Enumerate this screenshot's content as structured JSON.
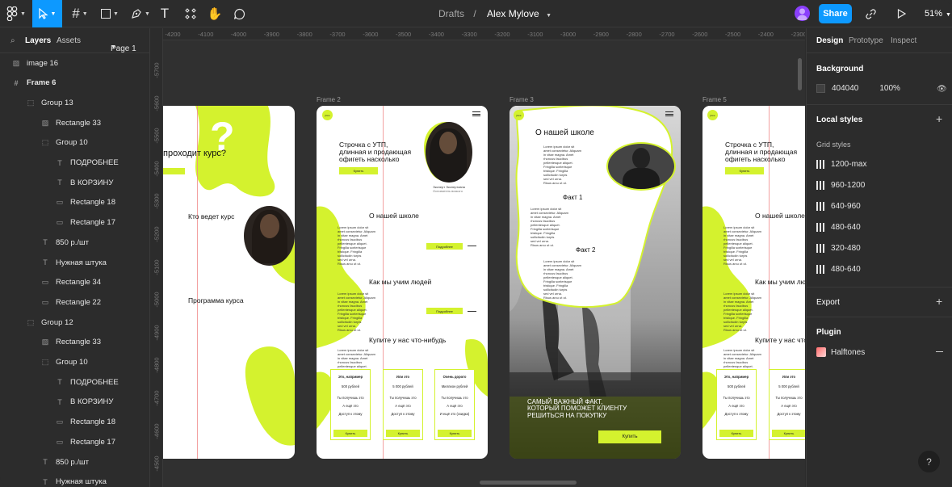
{
  "toolbar": {
    "breadcrumb_project": "Drafts",
    "file_name": "Alex Mylove",
    "share_label": "Share",
    "zoom_level": "51%"
  },
  "left_panel": {
    "tab_layers": "Layers",
    "tab_assets": "Assets",
    "page_selector": "Page 1",
    "layers": [
      {
        "name": "image 16",
        "icon": "image-icon"
      },
      {
        "name": "Frame 6",
        "icon": "frame-icon"
      },
      {
        "name": "Group 13",
        "icon": "group-icon"
      },
      {
        "name": "Rectangle 33",
        "icon": "image-icon"
      },
      {
        "name": "Group 10",
        "icon": "group-icon"
      },
      {
        "name": "ПОДРОБНЕЕ",
        "icon": "text-icon"
      },
      {
        "name": "В КОРЗИНУ",
        "icon": "text-icon"
      },
      {
        "name": "Rectangle 18",
        "icon": "rectangle-icon"
      },
      {
        "name": "Rectangle 17",
        "icon": "rectangle-icon"
      },
      {
        "name": "850 р./шт",
        "icon": "text-icon"
      },
      {
        "name": "Нужная штука",
        "icon": "text-icon"
      },
      {
        "name": "Rectangle 34",
        "icon": "rectangle-icon"
      },
      {
        "name": "Rectangle 22",
        "icon": "rectangle-icon"
      },
      {
        "name": "Group 12",
        "icon": "group-icon"
      },
      {
        "name": "Rectangle 33",
        "icon": "image-icon"
      },
      {
        "name": "Group 10",
        "icon": "group-icon"
      },
      {
        "name": "ПОДРОБНЕЕ",
        "icon": "text-icon"
      },
      {
        "name": "В КОРЗИНУ",
        "icon": "text-icon"
      },
      {
        "name": "Rectangle 18",
        "icon": "rectangle-icon"
      },
      {
        "name": "Rectangle 17",
        "icon": "rectangle-icon"
      },
      {
        "name": "850 р./шт",
        "icon": "text-icon"
      },
      {
        "name": "Нужная штука",
        "icon": "text-icon"
      }
    ]
  },
  "canvas": {
    "ruler_top": [
      "-4200",
      "-4100",
      "-4000",
      "-3900",
      "-3800",
      "-3700",
      "-3600",
      "-3500",
      "-3400",
      "-3300",
      "-3200",
      "-3100",
      "-3000",
      "-2900",
      "-2800",
      "-2700",
      "-2600",
      "-2500",
      "-2400",
      "-2300"
    ],
    "ruler_left": [
      "-5700",
      "-5600",
      "-5500",
      "-5400",
      "-5300",
      "-5200",
      "-5100",
      "-5000",
      "-4900",
      "-4800",
      "-4700",
      "-4600",
      "-4500",
      "-4400"
    ],
    "frame_labels": [
      "Frame 2",
      "Frame 3",
      "Frame 5"
    ],
    "frame6": {
      "question": "проходит курс?",
      "who": "Кто ведет курс",
      "program": "Программа курса"
    },
    "frame2": {
      "logo": "jlove",
      "hero_title": "Строчка с УТП,\nдлинная и продающая\nофигеть насколько",
      "hero_button": "Купить",
      "expert_name": "Эксперт Экспертовна",
      "expert_role": "Основатель всякого",
      "about_title": "О нашей школе",
      "how_title": "Как мы учим людей",
      "more_button": "Подробнее",
      "buy_title": "Купите у нас что-нибудь",
      "lorem": "Lorem ipsum dolor sit\namet consectetur. Aliquam\nin vitae magna. Amet\nrhoncus faucibus\npellentesque aliquet.\nFringilla scelerisque\ntristique. Fringilla\nsollicitudin turpis\nsed vel urna.\nRisus arcu ut ut.",
      "cards": [
        {
          "title": "Это, например",
          "price": "500 рублей",
          "l1": "Ты получишь это",
          "l2": "А ещё это",
          "l3": "Доступ к этому",
          "button": "Купить"
        },
        {
          "title": "Или это",
          "price": "5 000 рублей",
          "l1": "Ты получишь это",
          "l2": "А ещё это",
          "l3": "Доступ к этому",
          "button": "Купить"
        },
        {
          "title": "Очень дорого",
          "price": "Миллион рублей",
          "l1": "Ты получишь это",
          "l2": "А ещё это",
          "l3": "И ещё это (скидка)",
          "button": "Купить"
        }
      ]
    },
    "frame3": {
      "logo": "jlove",
      "about_title": "О нашей школе",
      "fact1": "Факт 1",
      "fact2": "Факт 2",
      "banner": "САМЫЙ ВАЖНЫЙ ФАКТ,\nКОТОРЫЙ ПОМОЖЕТ КЛИЕНТУ\nРЕШИТЬСЯ НА ПОКУПКУ",
      "buy_button": "Купить"
    },
    "frame5": {
      "logo": "jlove",
      "hero_title": "Строчка с УТП,\nдлинная и продающая\nофигеть насколько",
      "hero_button": "Купить",
      "about_title": "О нашей школе",
      "how_title": "Как мы учим людей",
      "buy_title": "Купите у нас что-нибудь",
      "cards": [
        {
          "title": "Это, например",
          "price": "500 рублей",
          "l1": "Ты получишь это",
          "l2": "А ещё это",
          "l3": "Доступ к этому",
          "button": "Купить"
        },
        {
          "title": "Или это",
          "price": "5 000 рублей",
          "l1": "Ты получишь это",
          "l2": "А ещё это",
          "l3": "Доступ к этому",
          "button": "Купить"
        }
      ]
    }
  },
  "right_panel": {
    "tab_design": "Design",
    "tab_prototype": "Prototype",
    "tab_inspect": "Inspect",
    "background_title": "Background",
    "background_hex": "404040",
    "background_opacity": "100%",
    "local_styles_title": "Local styles",
    "grid_styles_title": "Grid styles",
    "grid_styles": [
      "1200-max",
      "960-1200",
      "640-960",
      "480-640",
      "320-480",
      "480-640"
    ],
    "export_title": "Export",
    "plugin_title": "Plugin",
    "plugin_name": "Halftones"
  },
  "help_label": "?",
  "colors": {
    "accent": "#0d99ff",
    "lime": "#d4f22e",
    "panel": "#2c2c2c",
    "canvas": "#303030",
    "swatch": "#404040"
  }
}
